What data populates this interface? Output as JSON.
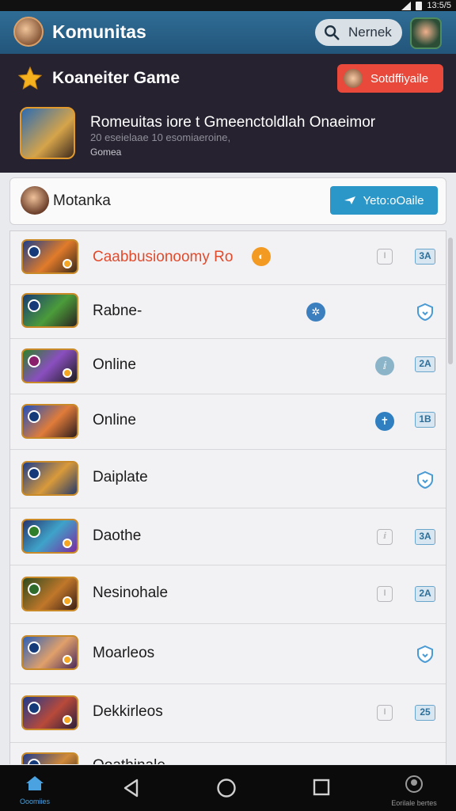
{
  "status_bar": {
    "time": "13:5/5"
  },
  "app_bar": {
    "title": "Komunitas",
    "search_label": "Nernek"
  },
  "featured": {
    "title": "Koaneiter Game",
    "action_label": "Sotdffiyaile",
    "headline": "Romeuitas iore t Gmeenctoldlah Onaeimor",
    "subline": "20 eseielaae 10 esomiaeroine,",
    "tag": "Gomea"
  },
  "search_card": {
    "title": "Motanka",
    "button_label": "Yeto:oOaile"
  },
  "items": [
    {
      "name": "Caabbusionoomy Ro",
      "highlight": true,
      "coin": "◐",
      "grey_chip": "I",
      "badge": "3A"
    },
    {
      "name": "Rabne-",
      "mid_icon": "✲",
      "shield": true
    },
    {
      "name": "Online",
      "mid_icon": "ⅈ",
      "badge": "2A"
    },
    {
      "name": "Online",
      "mid_icon": "✝",
      "badge": "1B"
    },
    {
      "name": "Daiplate",
      "shield": true
    },
    {
      "name": "Daothe",
      "grey_chip": "ⅈ",
      "badge": "3A"
    },
    {
      "name": "Nesinohale",
      "grey_chip": "I",
      "badge": "2A"
    },
    {
      "name": "Moarleos",
      "shield": true
    },
    {
      "name": "Dekkirleos",
      "grey_chip": "I",
      "badge": "25"
    },
    {
      "name": "Ooathinale"
    }
  ],
  "nav": {
    "home_label": "Ooomiies",
    "back_icon": "back-icon",
    "home_icon": "home-circle-icon",
    "recents_icon": "recents-icon",
    "right_label": "Eorilale bertes"
  },
  "colors": {
    "app_bar": "#2f6d96",
    "featured_bg": "#26222f",
    "accent_red": "#e8493a",
    "accent_blue": "#2b97c9"
  }
}
